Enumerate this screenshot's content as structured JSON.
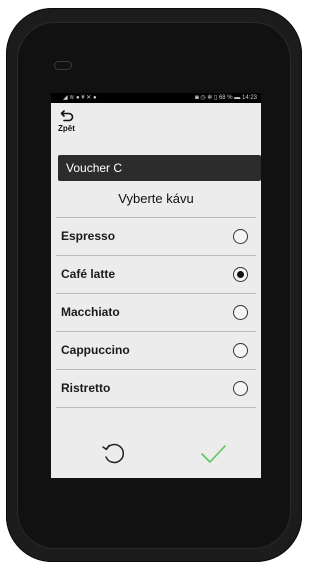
{
  "status_bar": {
    "left_icons": "◢ ≋ ● ¥ ✕ ●",
    "right_text": "◙ ◷ ✻ ▯ 68 % ▬ 14:23"
  },
  "back": {
    "label": "Zpět",
    "icon": "back-arrow-icon"
  },
  "voucher": {
    "label": "Voucher C"
  },
  "title": "Vyberte kávu",
  "options": [
    {
      "label": "Espresso",
      "selected": false
    },
    {
      "label": "Café latte",
      "selected": true
    },
    {
      "label": "Macchiato",
      "selected": false
    },
    {
      "label": "Cappuccino",
      "selected": false
    },
    {
      "label": "Ristretto",
      "selected": false
    }
  ],
  "actions": {
    "reset_icon": "refresh-icon",
    "confirm_icon": "checkmark-icon",
    "confirm_color": "#5cc75c"
  },
  "colors": {
    "screen_bg": "#ececec",
    "voucher_bg": "#2c2c2c",
    "device_body": "#1c1c1c"
  }
}
